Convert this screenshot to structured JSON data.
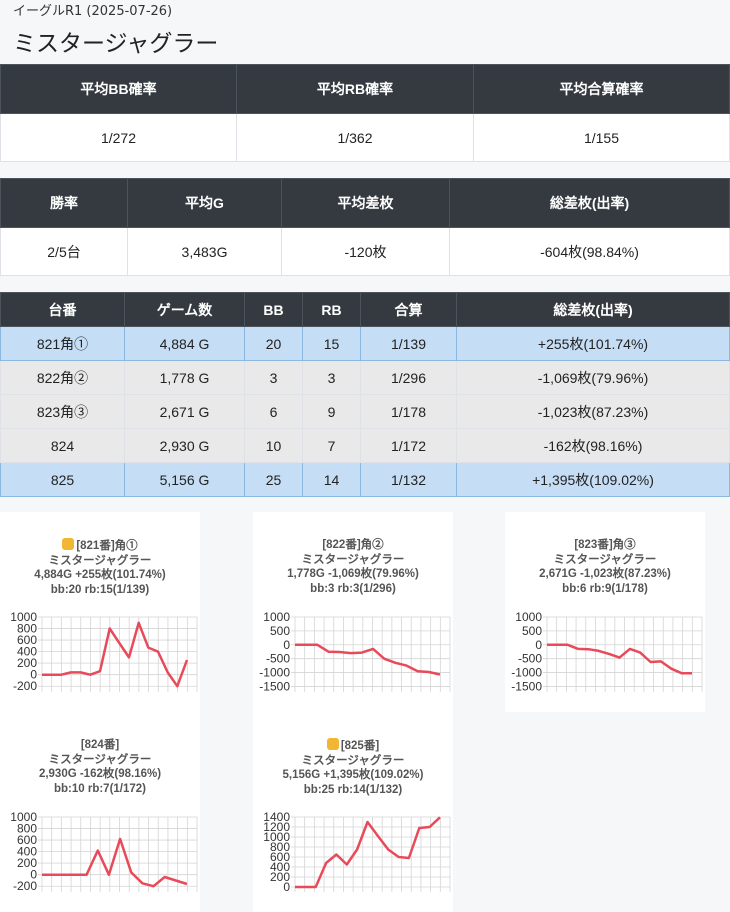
{
  "header": {
    "subtitle": "イーグルR1 (2025-07-26)",
    "title": "ミスタージャグラー"
  },
  "summary1": {
    "headers": [
      "平均BB確率",
      "平均RB確率",
      "平均合算確率"
    ],
    "values": [
      "1/272",
      "1/362",
      "1/155"
    ]
  },
  "summary2": {
    "headers": [
      "勝率",
      "平均G",
      "平均差枚",
      "総差枚(出率)"
    ],
    "values": [
      "2/5台",
      "3,483G",
      "-120枚",
      "-604枚(98.84%)"
    ]
  },
  "machines": {
    "headers": [
      "台番",
      "ゲーム数",
      "BB",
      "RB",
      "合算",
      "総差枚(出率)"
    ],
    "rows": [
      {
        "cells": [
          "821角①",
          "4,884 G",
          "20",
          "15",
          "1/139",
          "+255枚(101.74%)"
        ],
        "style": "hl"
      },
      {
        "cells": [
          "822角②",
          "1,778 G",
          "3",
          "3",
          "1/296",
          "-1,069枚(79.96%)"
        ],
        "style": "gr"
      },
      {
        "cells": [
          "823角③",
          "2,671 G",
          "6",
          "9",
          "1/178",
          "-1,023枚(87.23%)"
        ],
        "style": "gr"
      },
      {
        "cells": [
          "824",
          "2,930 G",
          "10",
          "7",
          "1/172",
          "-162枚(98.16%)"
        ],
        "style": "gr"
      },
      {
        "cells": [
          "825",
          "5,156 G",
          "25",
          "14",
          "1/132",
          "+1,395枚(109.02%)"
        ],
        "style": "hl"
      }
    ]
  },
  "colors": {
    "line": "#e84a5a",
    "grid": "#d4d4d4",
    "highlight_row": "#c5def5",
    "header_bg": "#343a40"
  },
  "chart_data": [
    {
      "type": "line",
      "thumb_icon": true,
      "caption": [
        "[821番]角①",
        "ミスタージャグラー",
        "4,884G +255枚(101.74%)",
        "bb:20 rb:15(1/139)"
      ],
      "yticks": [
        "1000",
        "800",
        "600",
        "400",
        "200",
        "0",
        "-200"
      ],
      "ylim": [
        -300,
        1000
      ],
      "values": [
        0,
        0,
        0,
        40,
        40,
        0,
        60,
        800,
        550,
        300,
        900,
        470,
        400,
        40,
        -200,
        255
      ]
    },
    {
      "type": "line",
      "thumb_icon": false,
      "caption": [
        "[822番]角②",
        "ミスタージャグラー",
        "1,778G -1,069枚(79.96%)",
        "bb:3 rb:3(1/296)"
      ],
      "yticks": [
        "1000",
        "500",
        "0",
        "-500",
        "-1000",
        "-1500"
      ],
      "ylim": [
        -1700,
        1000
      ],
      "values": [
        0,
        0,
        0,
        -250,
        -260,
        -300,
        -280,
        -150,
        -500,
        -650,
        -750,
        -950,
        -980,
        -1069
      ]
    },
    {
      "type": "line",
      "thumb_icon": false,
      "caption": [
        "[823番]角③",
        "ミスタージャグラー",
        "2,671G -1,023枚(87.23%)",
        "bb:6 rb:9(1/178)"
      ],
      "yticks": [
        "1000",
        "500",
        "0",
        "-500",
        "-1000",
        "-1500"
      ],
      "ylim": [
        -1700,
        1000
      ],
      "values": [
        0,
        0,
        0,
        -150,
        -160,
        -220,
        -330,
        -460,
        -150,
        -280,
        -620,
        -600,
        -860,
        -1023,
        -1023
      ]
    },
    {
      "type": "line",
      "thumb_icon": false,
      "caption": [
        "[824番]",
        "ミスタージャグラー",
        "2,930G -162枚(98.16%)",
        "bb:10 rb:7(1/172)"
      ],
      "yticks": [
        "1000",
        "800",
        "600",
        "400",
        "200",
        "0",
        "-200"
      ],
      "ylim": [
        -300,
        1000
      ],
      "values": [
        0,
        0,
        0,
        0,
        0,
        420,
        0,
        620,
        40,
        -150,
        -200,
        -40,
        -100,
        -162
      ]
    },
    {
      "type": "line",
      "thumb_icon": true,
      "caption": [
        "[825番]",
        "ミスタージャグラー",
        "5,156G +1,395枚(109.02%)",
        "bb:25 rb:14(1/132)"
      ],
      "yticks": [
        "1400",
        "1200",
        "1000",
        "800",
        "600",
        "400",
        "200",
        "0"
      ],
      "ylim": [
        -100,
        1400
      ],
      "values": [
        0,
        0,
        0,
        480,
        650,
        450,
        750,
        1300,
        1020,
        750,
        600,
        580,
        1180,
        1200,
        1395
      ]
    }
  ]
}
